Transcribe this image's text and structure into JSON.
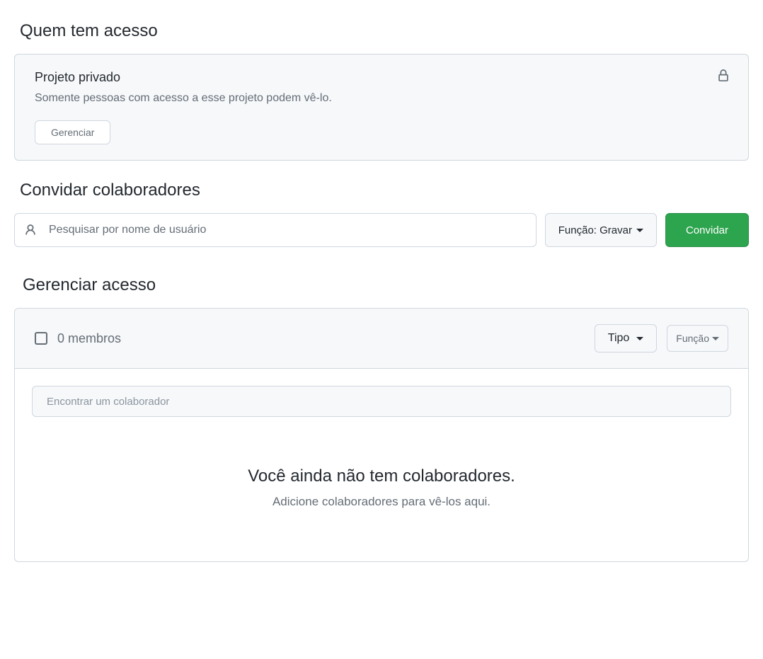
{
  "access": {
    "heading": "Quem tem acesso",
    "card_title": "Projeto privado",
    "card_desc": "Somente pessoas com acesso a esse projeto podem vê-lo.",
    "manage_btn": "Gerenciar"
  },
  "invite": {
    "heading": "Convidar colaboradores",
    "search_placeholder": "Pesquisar por nome de usuário",
    "role_label": "Função: Gravar",
    "invite_btn": "Convidar"
  },
  "manage": {
    "heading": "Gerenciar acesso",
    "members_label": "0 membros",
    "type_filter": "Tipo",
    "role_filter": "Função",
    "find_placeholder": "Encontrar um colaborador",
    "empty_title": "Você ainda não tem colaboradores.",
    "empty_desc": "Adicione colaboradores para vê-los aqui."
  }
}
